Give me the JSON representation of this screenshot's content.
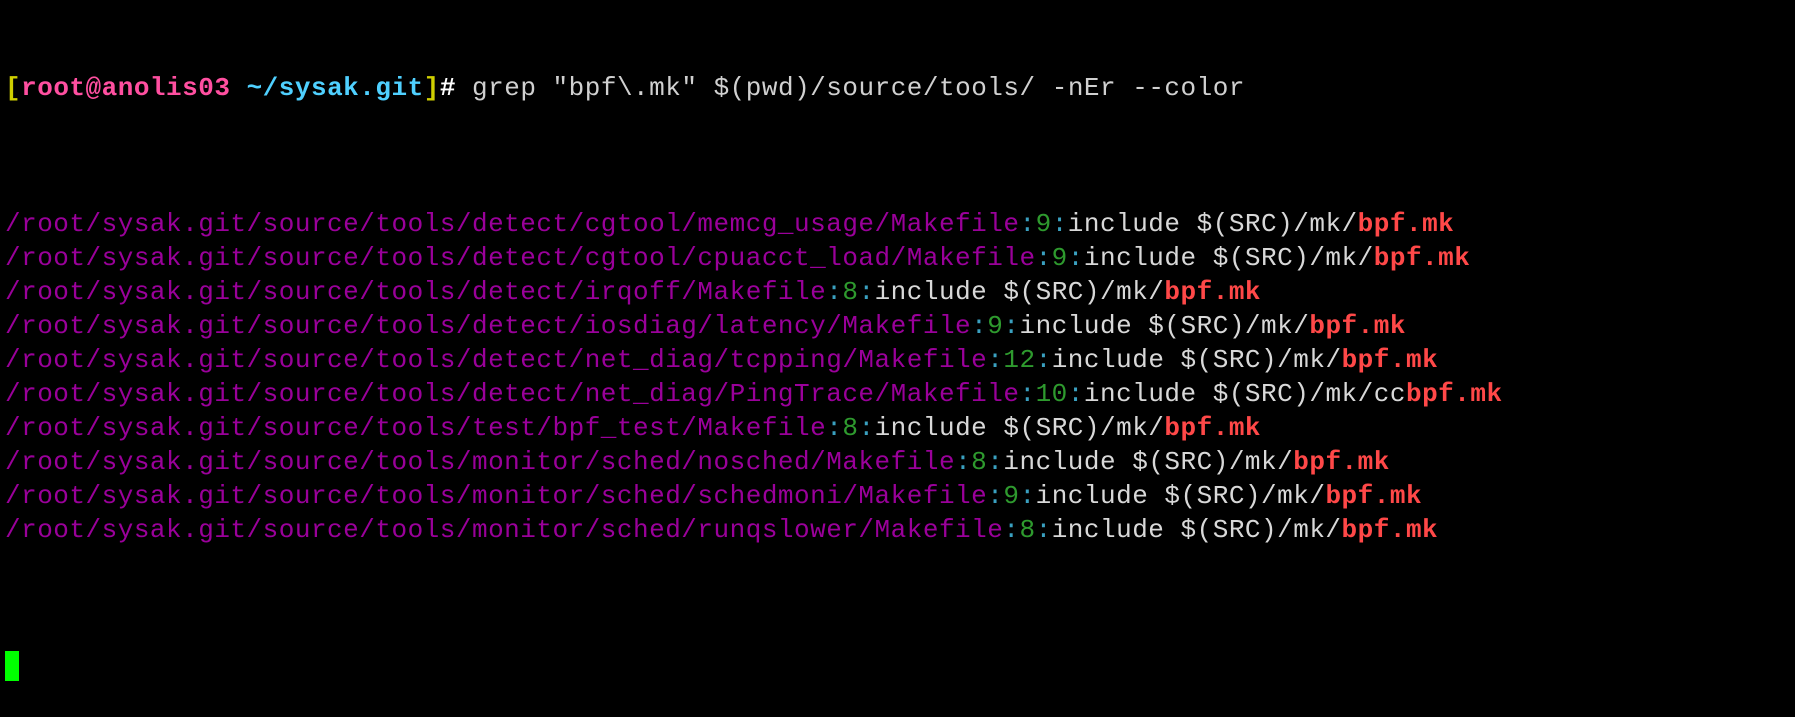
{
  "prompt": {
    "open_bracket": "[",
    "user_host": "root@anolis03",
    "space": " ",
    "cwd": "~/sysak.git",
    "close_bracket": "]",
    "hash": "#",
    "command": " grep \"bpf\\.mk\" $(pwd)/source/tools/ -nEr --color"
  },
  "colors": {
    "background": "#000000",
    "path": "#9a009a",
    "separator": "#3aa0c0",
    "line_number": "#2e9a2e",
    "match": "#ff4848",
    "cursor": "#00ff00"
  },
  "results": [
    {
      "path": "/root/sysak.git/source/tools/detect/cgtool/memcg_usage/Makefile",
      "lineno": "9",
      "prefix": "include $(SRC)/mk/",
      "match": "bpf.mk"
    },
    {
      "path": "/root/sysak.git/source/tools/detect/cgtool/cpuacct_load/Makefile",
      "lineno": "9",
      "prefix": "include $(SRC)/mk/",
      "match": "bpf.mk"
    },
    {
      "path": "/root/sysak.git/source/tools/detect/irqoff/Makefile",
      "lineno": "8",
      "prefix": "include $(SRC)/mk/",
      "match": "bpf.mk"
    },
    {
      "path": "/root/sysak.git/source/tools/detect/iosdiag/latency/Makefile",
      "lineno": "9",
      "prefix": "include $(SRC)/mk/",
      "match": "bpf.mk"
    },
    {
      "path": "/root/sysak.git/source/tools/detect/net_diag/tcpping/Makefile",
      "lineno": "12",
      "prefix": "include $(SRC)/mk/",
      "match": "bpf.mk"
    },
    {
      "path": "/root/sysak.git/source/tools/detect/net_diag/PingTrace/Makefile",
      "lineno": "10",
      "prefix": "include $(SRC)/mk/cc",
      "match": "bpf.mk"
    },
    {
      "path": "/root/sysak.git/source/tools/test/bpf_test/Makefile",
      "lineno": "8",
      "prefix": "include $(SRC)/mk/",
      "match": "bpf.mk"
    },
    {
      "path": "/root/sysak.git/source/tools/monitor/sched/nosched/Makefile",
      "lineno": "8",
      "prefix": "include $(SRC)/mk/",
      "match": "bpf.mk"
    },
    {
      "path": "/root/sysak.git/source/tools/monitor/sched/schedmoni/Makefile",
      "lineno": "9",
      "prefix": "include $(SRC)/mk/",
      "match": "bpf.mk"
    },
    {
      "path": "/root/sysak.git/source/tools/monitor/sched/runqslower/Makefile",
      "lineno": "8",
      "prefix": "include $(SRC)/mk/",
      "match": "bpf.mk"
    }
  ],
  "separator": ":"
}
